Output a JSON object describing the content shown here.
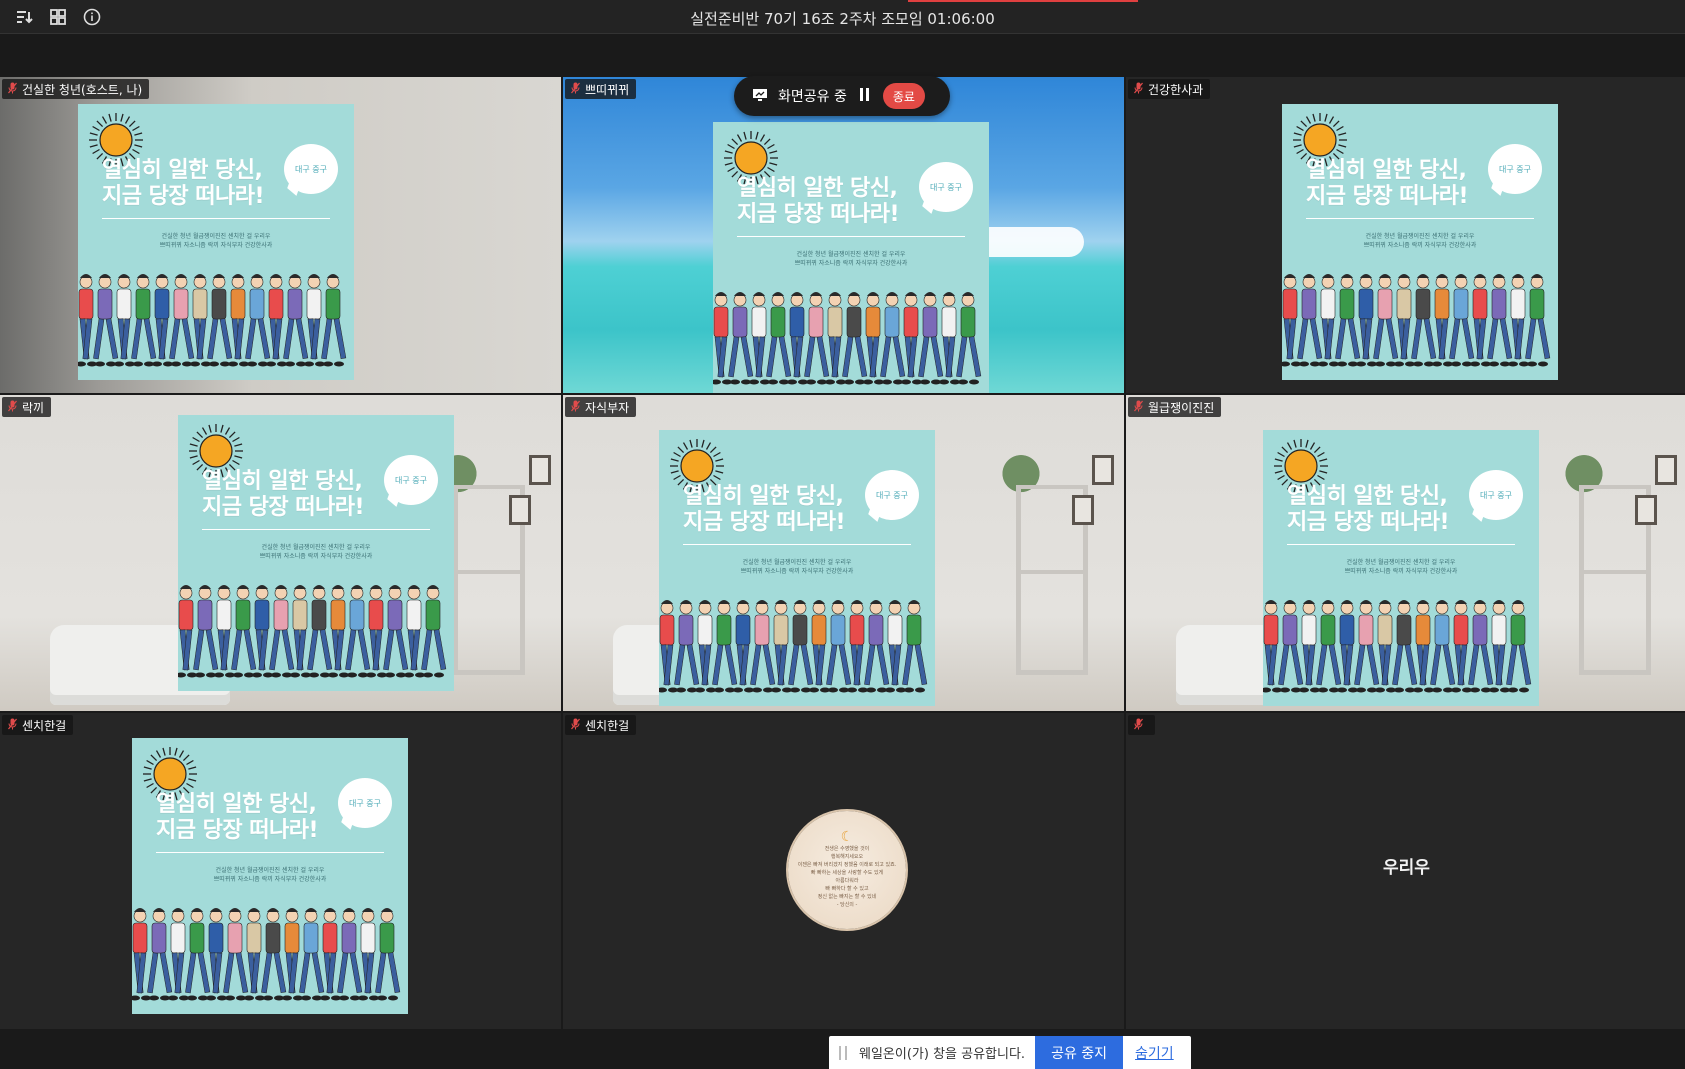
{
  "topbar": {
    "title": "실전준비반 70기 16조 2주차 조모임 01:06:00",
    "icons": [
      "sort-icon",
      "grid-view-icon",
      "info-icon"
    ]
  },
  "share_indicator": {
    "label": "화면공유 중",
    "stop_label": "종료"
  },
  "poster": {
    "headline_line1": "열심히 일한 당신,",
    "headline_line2": "지금 당장 떠나라!",
    "bubble": "대구 중구",
    "sub": "건실한 청년 월급쟁이진진 센치한 걸 우리우\n쁘띠뀌뀌 자소니즘 락끼 자식부자 건강한사과"
  },
  "participants": [
    {
      "name": "건실한 청년(호스트, 나)",
      "background": "wall",
      "has_poster": true,
      "mic_muted": false
    },
    {
      "name": "쁘띠뀌뀌",
      "background": "beach",
      "has_poster": true,
      "mic_muted": true
    },
    {
      "name": "건강한사과",
      "background": "dark",
      "has_poster": true,
      "mic_muted": true
    },
    {
      "name": "락끼",
      "background": "room",
      "has_poster": true,
      "mic_muted": true
    },
    {
      "name": "자식부자",
      "background": "room",
      "has_poster": true,
      "mic_muted": true
    },
    {
      "name": "월급쟁이진진",
      "background": "room",
      "has_poster": true,
      "mic_muted": true
    },
    {
      "name": "센치한걸",
      "background": "dark",
      "has_poster": true,
      "mic_muted": true
    },
    {
      "name": "센치한걸",
      "background": "dark",
      "has_poster": false,
      "avatar": true,
      "mic_muted": true
    },
    {
      "name": "",
      "background": "dark",
      "has_poster": false,
      "center_name": "우리우",
      "mic_muted": true
    }
  ],
  "avatar_text": "전생은 수영했을 것이\n행복해지세요오\n이젠은 빠져 버리겠지 정했음 이래로 되고 있죠.\n빠 빠하는 세상을 사랑할 수도 있게\n아름다워라\n빠 빠하다 할 수 있고\n정신 없는 빠지는 할 수 있네\n- 당신의 -",
  "bottom_bar": {
    "message": "웨일온이(가) 창을 공유합니다.",
    "stop_share": "공유 중지",
    "hide": "숨기기"
  },
  "colors": {
    "poster_bg": "#a3dbd9",
    "stop_red": "#e34a45",
    "accent_blue": "#2d6cdf"
  }
}
